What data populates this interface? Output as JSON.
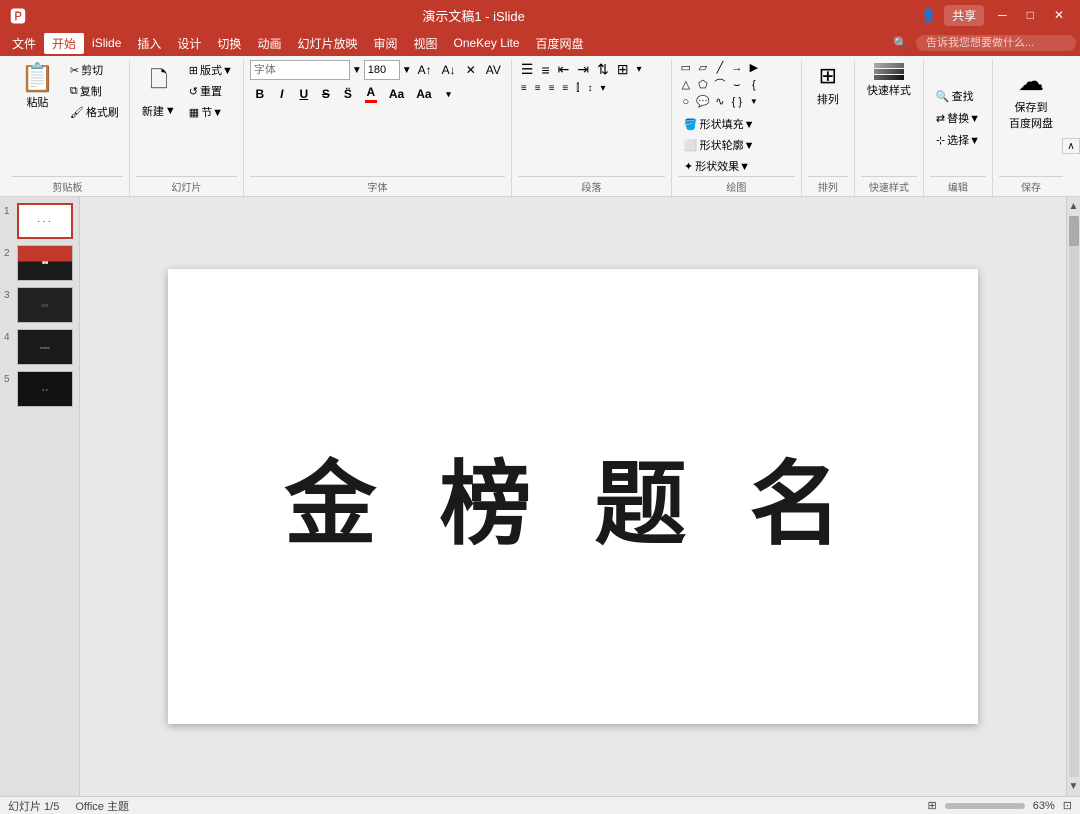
{
  "titlebar": {
    "title": "演示文稿1 - iSlide",
    "share_label": "共享",
    "user_icon": "👤"
  },
  "menubar": {
    "items": [
      "文件",
      "开始",
      "iSlide",
      "插入",
      "设计",
      "切换",
      "动画",
      "幻灯片放映",
      "审阅",
      "视图",
      "OneKey Lite",
      "百度网盘"
    ],
    "active": "开始"
  },
  "ribbon": {
    "groups": [
      {
        "label": "剪贴板",
        "id": "clipboard"
      },
      {
        "label": "幻灯片",
        "id": "slide"
      },
      {
        "label": "字体",
        "id": "font"
      },
      {
        "label": "段落",
        "id": "paragraph"
      },
      {
        "label": "绘图",
        "id": "drawing"
      },
      {
        "label": "排列",
        "id": "arrange"
      },
      {
        "label": "快速样式",
        "id": "quickstyle"
      },
      {
        "label": "编辑",
        "id": "edit"
      },
      {
        "label": "保存",
        "id": "save"
      }
    ],
    "clipboard": {
      "paste_label": "粘贴",
      "copy_label": "复制",
      "cut_label": "剪切",
      "format_painter_label": "格式刷"
    },
    "slide": {
      "new_label": "新建",
      "layout_label": "版式▼",
      "reset_label": "重置",
      "section_label": "节▼"
    },
    "font": {
      "font_name": "",
      "font_size": "180",
      "bold": "B",
      "italic": "I",
      "underline": "U",
      "strikethrough": "S",
      "font_color": "A",
      "increase_size": "A↑",
      "decrease_size": "A↓",
      "clear_format": "✕",
      "char_spacing": "AV"
    },
    "drawing": {
      "arrange_label": "排列",
      "quick_style_label": "快速样式",
      "shape_fill_label": "形状填充▼",
      "shape_outline_label": "形状轮廓▼",
      "shape_effect_label": "形状效果▼"
    },
    "edit": {
      "find_label": "查找",
      "replace_label": "替换▼",
      "select_label": "选择▼"
    },
    "save": {
      "save_cloud_label": "保存到\n百度网盘",
      "cloud_icon": "☁"
    }
  },
  "slidepanel": {
    "slides": [
      {
        "num": "1",
        "type": "blank_dots",
        "active": true
      },
      {
        "num": "2",
        "type": "red_dark"
      },
      {
        "num": "3",
        "type": "dark_text"
      },
      {
        "num": "4",
        "type": "dark_content"
      },
      {
        "num": "5",
        "type": "dark_title"
      }
    ]
  },
  "canvas": {
    "main_text": "金 榜 题 名"
  },
  "statusbar": {
    "slide_info": "幻灯片 1/5",
    "theme": "Office 主题",
    "zoom": "63%",
    "fit_label": "适应窗口"
  },
  "search": {
    "placeholder": "告诉我您想要做什么..."
  }
}
